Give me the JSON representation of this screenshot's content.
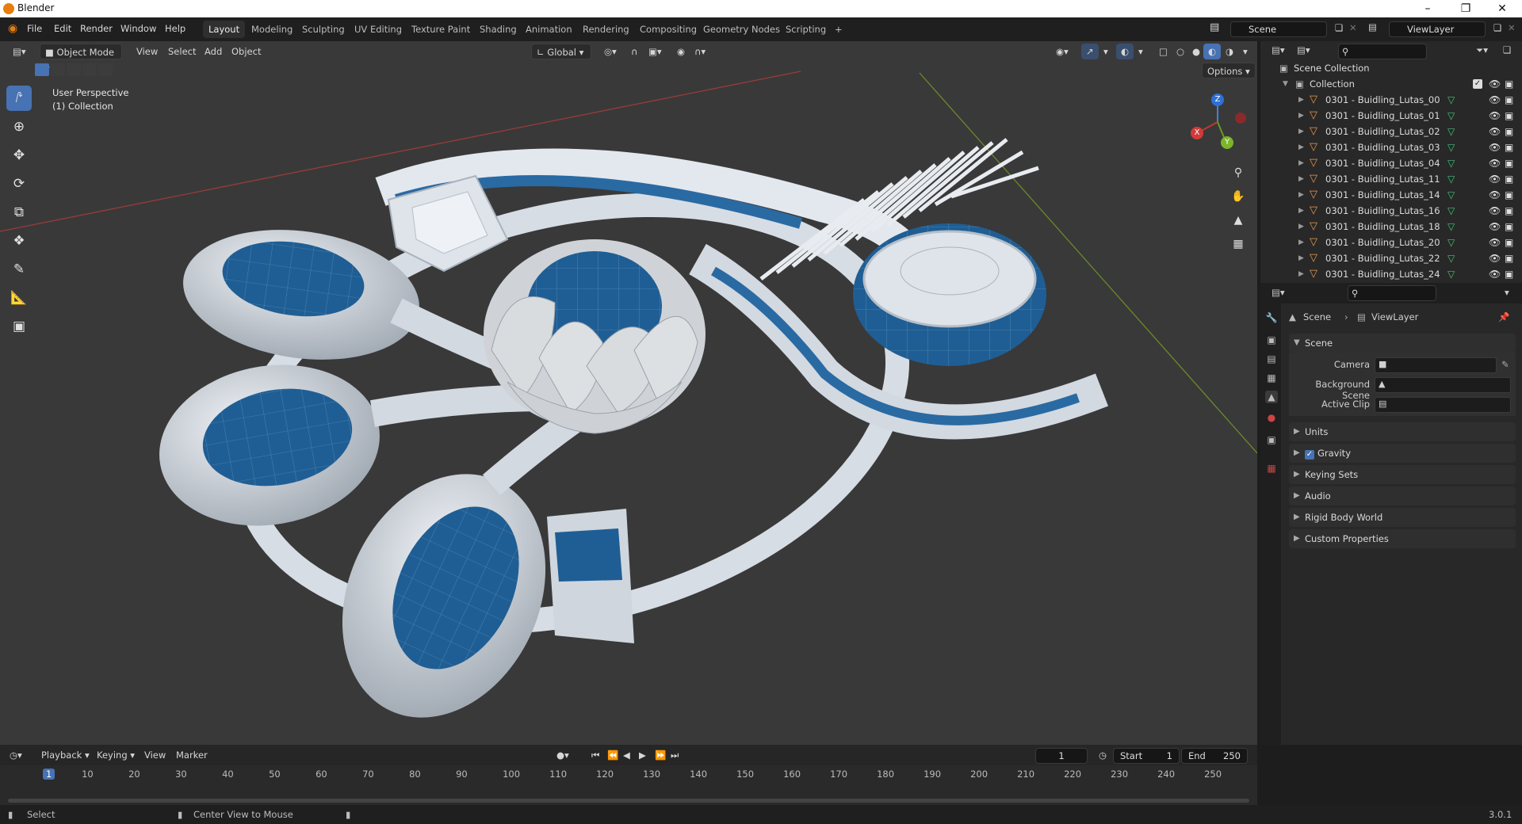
{
  "app": {
    "title": "Blender",
    "version": "3.0.1"
  },
  "menus": [
    "File",
    "Edit",
    "Render",
    "Window",
    "Help"
  ],
  "workspaces": [
    {
      "label": "Layout",
      "active": true
    },
    {
      "label": "Modeling"
    },
    {
      "label": "Sculpting"
    },
    {
      "label": "UV Editing"
    },
    {
      "label": "Texture Paint"
    },
    {
      "label": "Shading"
    },
    {
      "label": "Animation"
    },
    {
      "label": "Rendering"
    },
    {
      "label": "Compositing"
    },
    {
      "label": "Geometry Nodes"
    },
    {
      "label": "Scripting"
    }
  ],
  "add_workspace": "+",
  "scene_field": "Scene",
  "viewlayer_field": "ViewLayer",
  "viewport": {
    "mode": "Object Mode",
    "menus": [
      "View",
      "Select",
      "Add",
      "Object"
    ],
    "orientation": "Global",
    "options": "Options",
    "perspective": "User Perspective",
    "collection": "(1) Collection",
    "gizmo": {
      "x": "X",
      "y": "Y",
      "z": "Z"
    }
  },
  "outliner": {
    "root": "Scene Collection",
    "collection": "Collection",
    "objects": [
      "0301 - Buidling_Lutas_00",
      "0301 - Buidling_Lutas_01",
      "0301 - Buidling_Lutas_02",
      "0301 - Buidling_Lutas_03",
      "0301 - Buidling_Lutas_04",
      "0301 - Buidling_Lutas_11",
      "0301 - Buidling_Lutas_14",
      "0301 - Buidling_Lutas_16",
      "0301 - Buidling_Lutas_18",
      "0301 - Buidling_Lutas_20",
      "0301 - Buidling_Lutas_22",
      "0301 - Buidling_Lutas_24"
    ]
  },
  "properties": {
    "breadcrumb": {
      "scene": "Scene",
      "viewlayer": "ViewLayer"
    },
    "panel_title": "Scene",
    "fields": [
      {
        "label": "Camera"
      },
      {
        "label": "Background Scene"
      },
      {
        "label": "Active Clip"
      }
    ],
    "sections": [
      {
        "label": "Units"
      },
      {
        "label": "Gravity",
        "checked": true
      },
      {
        "label": "Keying Sets"
      },
      {
        "label": "Audio"
      },
      {
        "label": "Rigid Body World"
      },
      {
        "label": "Custom Properties"
      }
    ]
  },
  "timeline": {
    "menus": [
      "Playback",
      "Keying",
      "View",
      "Marker"
    ],
    "current_frame": "1",
    "start_label": "Start",
    "start": "1",
    "end_label": "End",
    "end": "250",
    "ticks": [
      "1",
      "10",
      "20",
      "30",
      "40",
      "50",
      "60",
      "70",
      "80",
      "90",
      "100",
      "110",
      "120",
      "130",
      "140",
      "150",
      "160",
      "170",
      "180",
      "190",
      "200",
      "210",
      "220",
      "230",
      "240",
      "250"
    ]
  },
  "status": {
    "select": "Select",
    "center": "Center View to Mouse"
  },
  "colors": {
    "accent": "#4772b3",
    "object": "#e89b4b",
    "mesh": "#43c67a",
    "glass": "#1f5e94",
    "axis_x": "#c0392b",
    "axis_y": "#6a9a1f"
  }
}
